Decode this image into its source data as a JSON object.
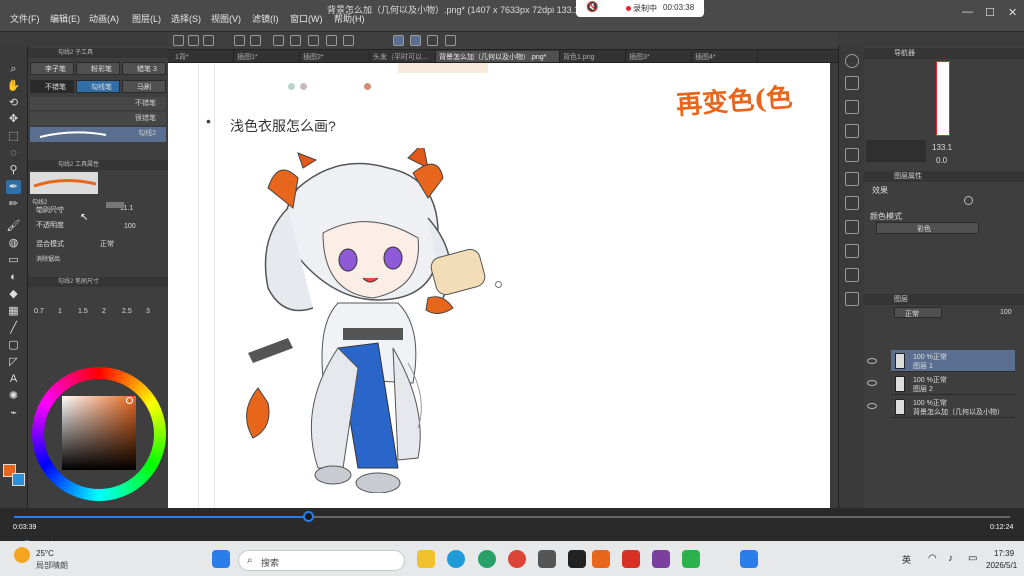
{
  "window": {
    "title": "背景怎么加（几何以及小物）.png* (1407 x 7633px 72dpi 133.1%) - CLIP STUDIO PAINT PRO",
    "controls": [
      "—",
      "☐",
      "✕"
    ]
  },
  "menu": [
    "文件(F)",
    "编辑(E)",
    "动画(A)",
    "图层(L)",
    "选择(S)",
    "视图(V)",
    "滤镜(I)",
    "窗口(W)",
    "帮助(H)"
  ],
  "recording": {
    "label": "录制中",
    "time": "00:03:38"
  },
  "doc_tabs": [
    {
      "label": "1背*",
      "active": false
    },
    {
      "label": "插图1*",
      "active": false
    },
    {
      "label": "插图2*",
      "active": false
    },
    {
      "label": "头发（平时可以...",
      "active": false
    },
    {
      "label": "背景怎么加（几何以及小物）.png*",
      "active": true
    },
    {
      "label": "背色1.png",
      "active": false
    },
    {
      "label": "插图3*",
      "active": false
    },
    {
      "label": "插图4*",
      "active": false
    }
  ],
  "sub_tool": {
    "title": "勾线2 子工具",
    "tabs": [
      "李子笔",
      "粉彩笔",
      "蜡笔 3"
    ],
    "tabs2": [
      "不错笔",
      "勾线笔",
      "马刷"
    ],
    "brushes": [
      {
        "label": "不错笔"
      },
      {
        "label": "很错笔"
      },
      {
        "label": "勾线2"
      }
    ]
  },
  "tool_property": {
    "title": "勾线2 工具属性",
    "preset": "勾线2",
    "brush_size_label": "笔刷尺寸",
    "brush_size_value": "11.1",
    "opacity_label": "不透明度",
    "opacity_value": "100",
    "blend_label": "混合模式",
    "blend_value": "正常",
    "aa_label": "消除锯齿"
  },
  "brush_size_panel": {
    "title": "勾线2 笔刷尺寸",
    "sizes": [
      "0.7",
      "1",
      "1.5",
      "2",
      "2.5",
      "3"
    ]
  },
  "colors": {
    "main": "#e8661c",
    "sub": "#2a8fd6",
    "accent": "#2b7de9"
  },
  "tools": [
    "zoom-icon",
    "hand-icon",
    "rotate-icon",
    "move-icon",
    "lasso-icon",
    "eyedropper-icon",
    "pen-icon",
    "pencil-icon",
    "brush-icon",
    "airbrush-icon",
    "eraser-icon",
    "blend-icon",
    "fill-icon",
    "gradient-icon",
    "figure-icon",
    "frame-icon",
    "ruler-icon",
    "text-icon",
    "balloon-icon",
    "line-correction-icon",
    "color-icon"
  ],
  "canvas": {
    "bullet_text": "浅色衣服怎么画?",
    "handwriting": "再变色(色",
    "zoom": "133.1",
    "angle": "0.0"
  },
  "navigator": {
    "title": "导航器",
    "zoom": "133.1",
    "angle": "0.0"
  },
  "layer_property": {
    "title": "图层属性",
    "effect_label": "效果",
    "color_mode_label": "颜色模式",
    "color_mode_value": "彩色"
  },
  "layers_panel": {
    "title": "图层",
    "blend": "正常",
    "opacity": "100",
    "items": [
      {
        "pct": "100 %正常",
        "name": "图层 1",
        "selected": true
      },
      {
        "pct": "100 %正常",
        "name": "图层 2",
        "selected": false
      },
      {
        "pct": "100 %正常",
        "name": "背景怎么加（几何以及小物）",
        "selected": false
      }
    ]
  },
  "video": {
    "current": "0:03:39",
    "total": "0:12:24",
    "progress": 0.295
  },
  "taskbar": {
    "weather_temp": "25°C",
    "weather_desc": "局部晴朗",
    "search_placeholder": "搜索",
    "time": "17:39",
    "date": "2026/5/1",
    "ime": "英",
    "app_icons": [
      {
        "name": "start-icon",
        "color": "#2b7de9"
      },
      {
        "name": "file-explorer-icon",
        "color": "#f2c12e"
      },
      {
        "name": "edge-icon",
        "color": "#1f9bd9"
      },
      {
        "name": "browser-icon",
        "color": "#27a06a"
      },
      {
        "name": "chrome-icon",
        "color": "#db4437"
      },
      {
        "name": "app-dark-icon",
        "color": "#222222"
      },
      {
        "name": "clip-studio-icon",
        "color": "#e8661c"
      },
      {
        "name": "wps-icon",
        "color": "#d93025"
      },
      {
        "name": "onenote-icon",
        "color": "#7b3fa0"
      },
      {
        "name": "chat-icon",
        "color": "#2bb24c"
      },
      {
        "name": "media-icon",
        "color": "#2b7de9"
      }
    ]
  }
}
